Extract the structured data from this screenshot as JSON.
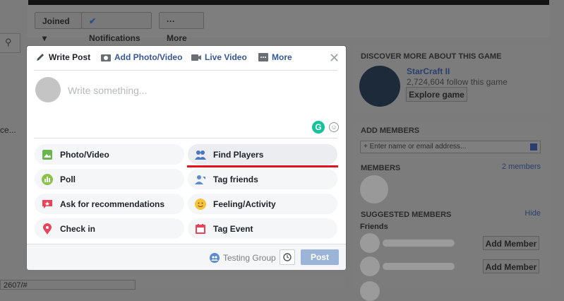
{
  "background": {
    "left_fragment": "ce...",
    "status_url": "2607/#",
    "buttons": {
      "joined": "Joined",
      "notifications": "Notifications",
      "more": "More"
    }
  },
  "composer": {
    "tabs": [
      {
        "label": "Write Post",
        "icon": "pencil-icon"
      },
      {
        "label": "Add Photo/Video",
        "icon": "camera-icon"
      },
      {
        "label": "Live Video",
        "icon": "video-camera-icon"
      },
      {
        "label": "More",
        "icon": "ellipsis-box-icon"
      }
    ],
    "placeholder": "Write something...",
    "options": [
      {
        "label": "Photo/Video",
        "icon": "photo-icon",
        "color": "#6bb54f"
      },
      {
        "label": "Find Players",
        "icon": "players-icon",
        "color": "#4a76c6"
      },
      {
        "label": "Poll",
        "icon": "poll-icon",
        "color": "#8bc34a"
      },
      {
        "label": "Tag friends",
        "icon": "tag-friends-icon",
        "color": "#5b8ccf"
      },
      {
        "label": "Ask for recommendations",
        "icon": "recommendation-icon",
        "color": "#e9435a"
      },
      {
        "label": "Feeling/Activity",
        "icon": "smiley-icon",
        "color": "#f7c33c"
      },
      {
        "label": "Check in",
        "icon": "location-pin-icon",
        "color": "#e9435a"
      },
      {
        "label": "Tag Event",
        "icon": "calendar-icon",
        "color": "#e9435a"
      }
    ],
    "footer": {
      "group": "Testing Group",
      "post": "Post"
    },
    "highlight_color": "#e4111c"
  },
  "right": {
    "discover_header": "DISCOVER MORE ABOUT THIS GAME",
    "game_name": "StarCraft II",
    "followers": "2,724,604 follow this game",
    "explore": "Explore game",
    "add_members_header": "ADD MEMBERS",
    "add_members_placeholder": "+ Enter name or email address...",
    "members_header": "MEMBERS",
    "members_count": "2 members",
    "suggested_header": "SUGGESTED MEMBERS",
    "hide": "Hide",
    "friends": "Friends",
    "add_member": "Add Member"
  }
}
